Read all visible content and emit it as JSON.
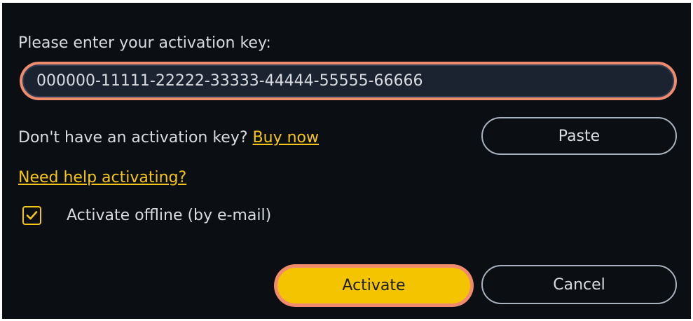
{
  "dialog": {
    "prompt_label": "Please enter your activation key:",
    "key_input": {
      "value": "000000-11111-22222-33333-44444-55555-66666",
      "placeholder": ""
    },
    "no_key_text": "Don't have an activation key?",
    "buy_now_link": "Buy now",
    "paste_button": "Paste",
    "help_link": "Need help activating?",
    "offline": {
      "label": "Activate offline (by e-mail)",
      "checked": true,
      "icon": "checkmark-icon"
    },
    "activate_button": "Activate",
    "cancel_button": "Cancel"
  },
  "colors": {
    "background": "#0b0f13",
    "text": "#d8dce1",
    "accent_yellow": "#f5c518",
    "highlight_orange": "#f08b6e",
    "input_fill": "#1b2230",
    "button_border": "#aab2be"
  }
}
